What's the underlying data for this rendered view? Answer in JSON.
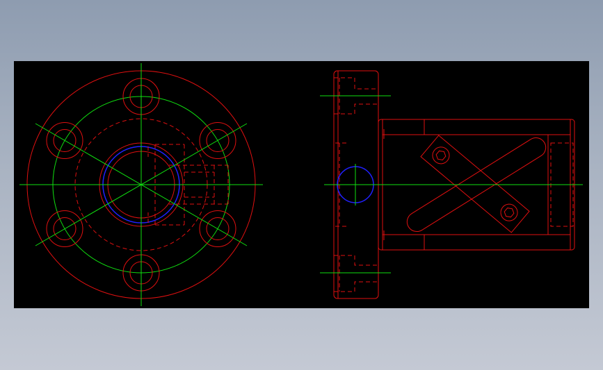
{
  "drawing": {
    "background_color": "#000000",
    "colors": {
      "outline": "#e01010",
      "centerline": "#10e010",
      "bore": "#2020ff"
    },
    "views": [
      {
        "name": "front-view",
        "description_icon": "flange-circle-icon"
      },
      {
        "name": "side-view",
        "description_icon": "flange-side-icon"
      }
    ],
    "bolt_hole_count": 6
  }
}
